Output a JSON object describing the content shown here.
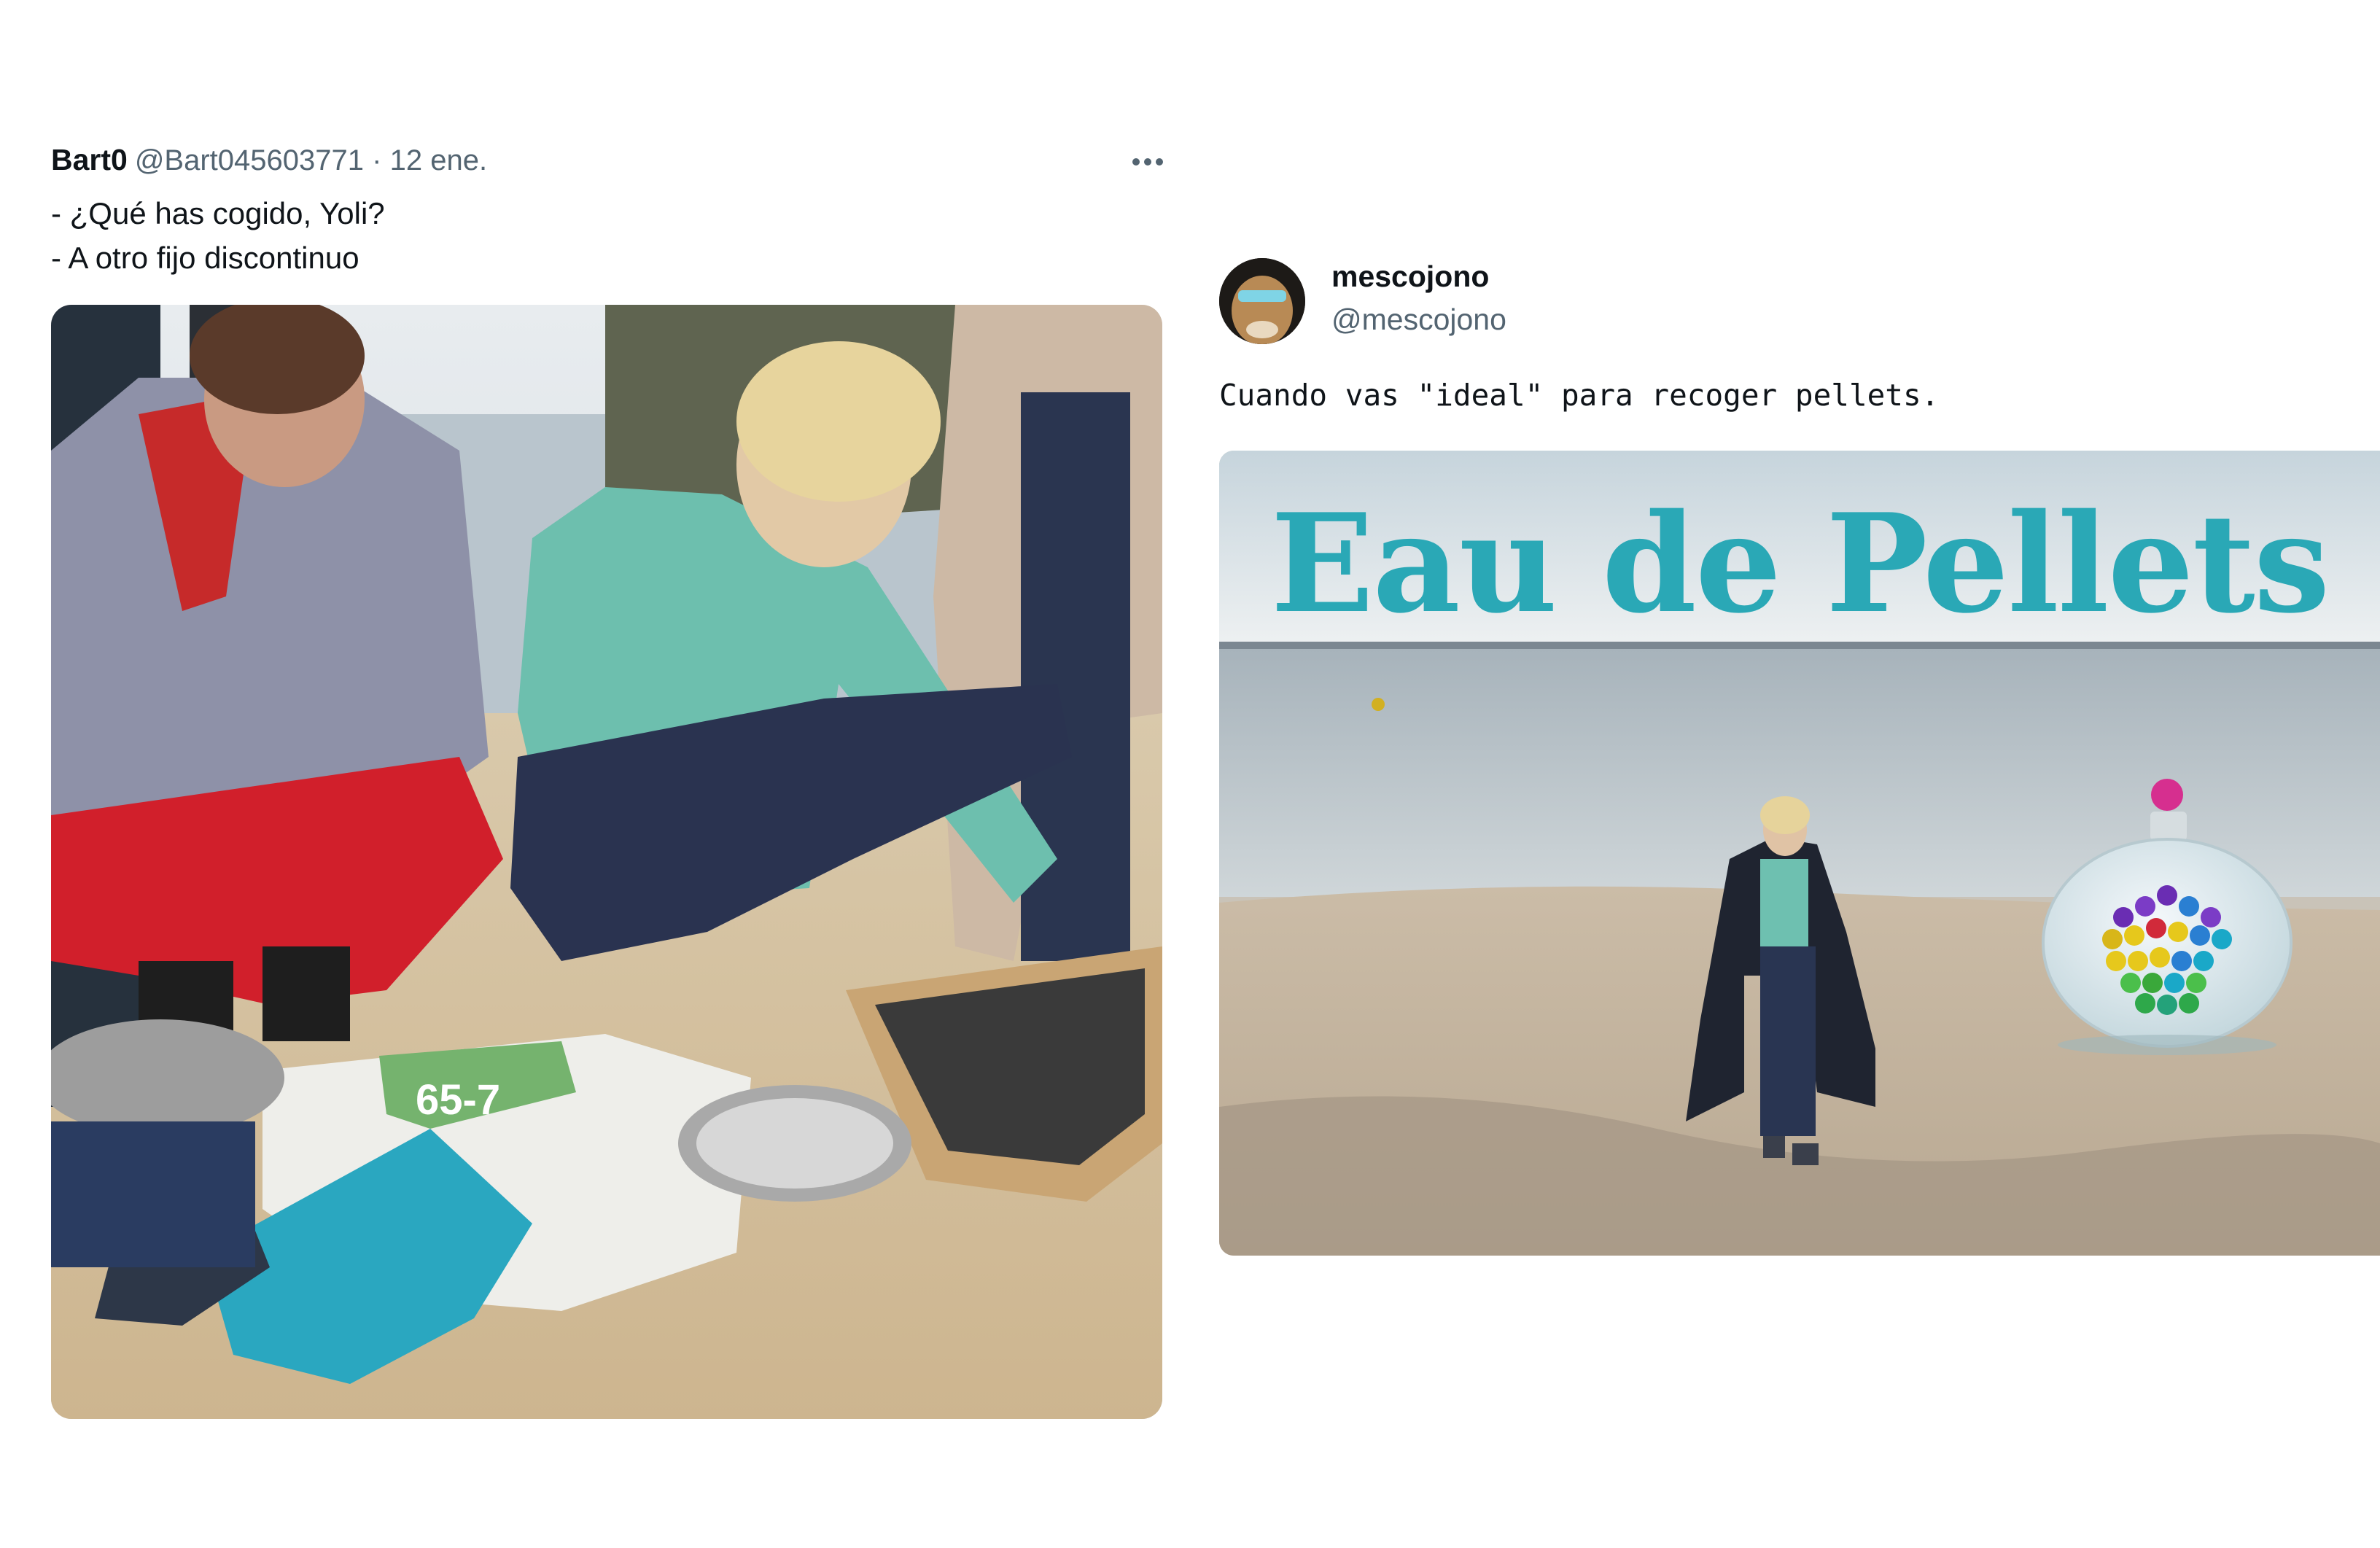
{
  "tweet_left": {
    "author_name": "Bart0",
    "author_handle": "@Bart045603771",
    "separator": "·",
    "date": "12 ene.",
    "more_icon": "more-horizontal-icon",
    "text_lines": [
      "- ¿Qué has cogido, Yoli?",
      "- A otro fijo discontinuo"
    ],
    "image": {
      "bag_label": "65-7"
    }
  },
  "tweet_right": {
    "author_name": "mescojono",
    "author_handle": "@mescojono",
    "text": "Cuando vas \"ideal\" para recoger pellets.",
    "image": {
      "title": "Eau de Pellets"
    }
  },
  "colors": {
    "text_primary": "#0f1419",
    "text_secondary": "#536471",
    "title_teal": "#2aa8b6"
  }
}
